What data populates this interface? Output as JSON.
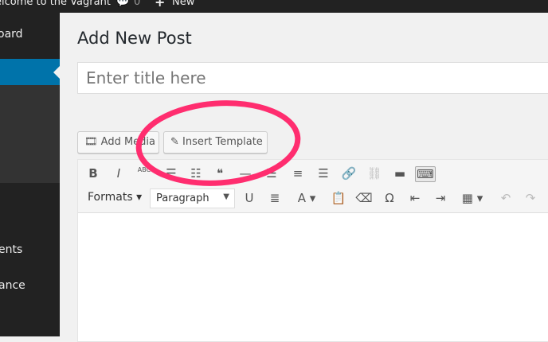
{
  "topbar": {
    "site": "elcome to the Vagrant",
    "comments": "0",
    "new": "New",
    "new_icon": "plus-icon",
    "comment_icon": "comment-bubble-icon"
  },
  "sidebar": {
    "items": [
      {
        "label": "oard"
      },
      {
        "label": "ents"
      },
      {
        "label": "ance"
      }
    ]
  },
  "page": {
    "title": "Add New Post",
    "title_placeholder": "Enter title here"
  },
  "buttons": {
    "add_media": "Add Media",
    "insert_template": "Insert Template"
  },
  "toolbar": {
    "row1": [
      {
        "icon": "B",
        "name": "bold-icon"
      },
      {
        "icon": "I",
        "name": "italic-icon"
      },
      {
        "icon": "ABC",
        "name": "strikethrough-icon"
      },
      {
        "icon": "☰",
        "name": "bullet-list-icon"
      },
      {
        "icon": "☷",
        "name": "numbered-list-icon"
      },
      {
        "icon": "❝",
        "name": "blockquote-icon"
      },
      {
        "icon": "—",
        "name": "horizontal-rule-icon"
      },
      {
        "icon": "☰",
        "name": "align-left-icon"
      },
      {
        "icon": "≡",
        "name": "align-center-icon"
      },
      {
        "icon": "☰",
        "name": "align-right-icon"
      },
      {
        "icon": "🔗",
        "name": "link-icon"
      },
      {
        "icon": "⛓",
        "name": "unlink-icon"
      },
      {
        "icon": "▬",
        "name": "read-more-icon"
      },
      {
        "icon": "⌨",
        "name": "toolbar-toggle-icon"
      }
    ],
    "formats": "Formats ▾",
    "paragraph": "Paragraph",
    "row2": [
      {
        "icon": "U",
        "name": "underline-icon"
      },
      {
        "icon": "≣",
        "name": "justify-icon"
      },
      {
        "icon": "A ▾",
        "name": "text-color-icon"
      },
      {
        "icon": "📋",
        "name": "paste-text-icon"
      },
      {
        "icon": "⌫",
        "name": "clear-formatting-icon"
      },
      {
        "icon": "Ω",
        "name": "special-character-icon"
      },
      {
        "icon": "⇤",
        "name": "outdent-icon"
      },
      {
        "icon": "⇥",
        "name": "indent-icon"
      },
      {
        "icon": "▦ ▾",
        "name": "table-icon"
      },
      {
        "icon": "↶",
        "name": "undo-icon"
      },
      {
        "icon": "↷",
        "name": "redo-icon"
      }
    ]
  },
  "annotation_color": "#ff2d6f"
}
